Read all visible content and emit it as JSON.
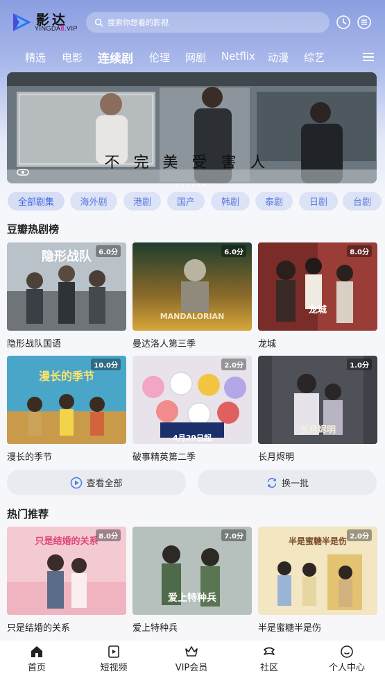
{
  "app": {
    "logo_title": "影达",
    "logo_sub_prefix": "YINGDA",
    "logo_sub_accent": "8",
    "logo_sub_suffix": ".VIP",
    "search_placeholder": "搜索你想看的影视"
  },
  "nav": {
    "items": [
      "精选",
      "电影",
      "连续剧",
      "伦理",
      "网剧",
      "Netflix",
      "动漫",
      "综艺"
    ],
    "active": "连续剧"
  },
  "banner": {
    "caption": "不完美受害人",
    "dots_total": 7,
    "dots_active": 5
  },
  "chips": [
    "全部剧集",
    "海外剧",
    "港剧",
    "国产",
    "韩剧",
    "泰剧",
    "日剧",
    "台剧"
  ],
  "douban": {
    "title": "豆瓣热剧榜",
    "items": [
      {
        "title": "隐形战队国语",
        "score": "6.0分",
        "poster_text": "隐形战队"
      },
      {
        "title": "曼达洛人第三季",
        "score": "6.0分",
        "poster_text": "MANDALORIAN"
      },
      {
        "title": "龙城",
        "score": "8.0分",
        "poster_text": "龙城"
      },
      {
        "title": "漫长的季节",
        "score": "10.0分",
        "poster_text": "漫长的季节"
      },
      {
        "title": "破事精英第二季",
        "score": "2.0分",
        "poster_text": "4月29日起"
      },
      {
        "title": "长月烬明",
        "score": "1.0分",
        "poster_text": "长月烬明"
      }
    ],
    "view_all": "查看全部",
    "refresh": "换一批"
  },
  "hot": {
    "title": "热门推荐",
    "items": [
      {
        "title": "只是结婚的关系",
        "score": "8.0分",
        "poster_text": "只是结婚的关系"
      },
      {
        "title": "爱上特种兵",
        "score": "7.0分",
        "poster_text": "爱上特种兵"
      },
      {
        "title": "半是蜜糖半是伤",
        "score": "2.0分",
        "poster_text": "半是蜜糖半是伤"
      }
    ]
  },
  "tabbar": [
    "首页",
    "短视频",
    "VIP会员",
    "社区",
    "个人中心"
  ],
  "colors": {
    "accent": "#4169e1",
    "chip_bg": "#dde3f6",
    "badge_bg": "#00000059"
  }
}
